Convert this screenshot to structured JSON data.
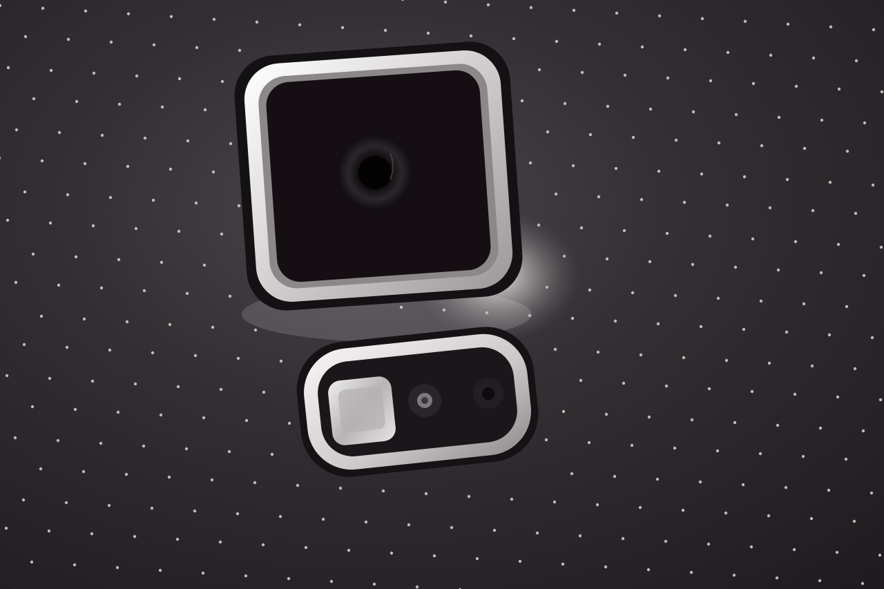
{
  "scene": {
    "subject": "phone-back-camera-closeup",
    "palette": {
      "surface_dark": "#1c1a1d",
      "surface_mid": "#3a373b",
      "surface_light": "#6e6a6d",
      "highlight": "#e9e6e6",
      "perforation": "#d8d6d6",
      "chrome": "#f4f2f2",
      "lens_black": "#0b080b"
    },
    "icons": [
      "camera-lens-icon",
      "flash-led-icon",
      "heart-rate-sensor-icon"
    ]
  }
}
